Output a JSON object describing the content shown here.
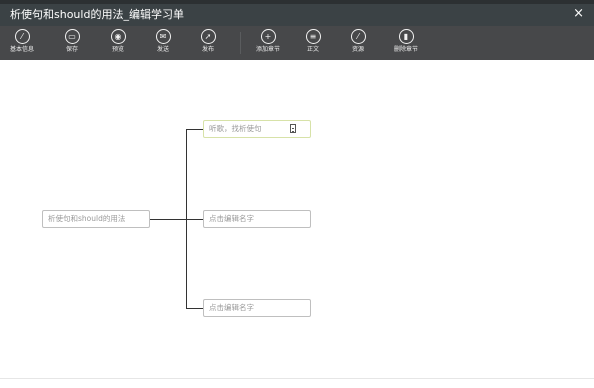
{
  "window": {
    "title": "析使句和should的用法_编辑学习单",
    "close_icon": "×"
  },
  "toolbar": {
    "items": [
      {
        "label": "基本信息",
        "icon": "pencil-icon",
        "glyph": "⁄"
      },
      {
        "label": "保存",
        "icon": "save-icon",
        "glyph": "▭"
      },
      {
        "label": "预览",
        "icon": "eye-icon",
        "glyph": "◉"
      },
      {
        "label": "发送",
        "icon": "send-icon",
        "glyph": "✉"
      },
      {
        "label": "发布",
        "icon": "cursor-icon",
        "glyph": "➚"
      },
      {
        "label": "添加章节",
        "icon": "plus-icon",
        "glyph": "+"
      },
      {
        "label": "正文",
        "icon": "document-icon",
        "glyph": "≡"
      },
      {
        "label": "资源",
        "icon": "pencil-icon",
        "glyph": "⁄"
      },
      {
        "label": "删除章节",
        "icon": "trash-icon",
        "glyph": "▮"
      }
    ]
  },
  "mindmap": {
    "root": "析使句和should的用法",
    "children": [
      {
        "label": "听歌，找析使句",
        "icon": "document-icon"
      },
      {
        "label": "点击编辑名字"
      },
      {
        "label": "点击编辑名字"
      }
    ]
  },
  "colors": {
    "titlebar": "#3b4245",
    "toolbar": "#47484a",
    "active_border": "#d7e2a8"
  }
}
